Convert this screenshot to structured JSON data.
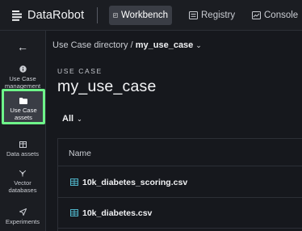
{
  "header": {
    "brand": "DataRobot",
    "nav": [
      {
        "label": "Workbench",
        "icon": "workbench-icon",
        "active": true
      },
      {
        "label": "Registry",
        "icon": "registry-icon",
        "active": false
      },
      {
        "label": "Console",
        "icon": "console-icon",
        "active": false
      }
    ]
  },
  "sidebar": {
    "back_icon": "arrow-left-icon",
    "items": [
      {
        "label": "Use Case management",
        "icon": "info-icon",
        "selected": false
      },
      {
        "label": "Use Case assets",
        "icon": "folder-icon",
        "selected": true
      },
      {
        "label": "Data assets",
        "icon": "table-icon",
        "selected": false
      },
      {
        "label": "Vector databases",
        "icon": "vector-icon",
        "selected": false
      },
      {
        "label": "Experiments",
        "icon": "experiments-icon",
        "selected": false
      }
    ]
  },
  "main": {
    "breadcrumb": {
      "parent": "Use Case directory",
      "separator": "/",
      "current": "my_use_case"
    },
    "overline": "USE CASE",
    "title": "my_use_case",
    "filter": "All",
    "table": {
      "columns": [
        "Name"
      ],
      "rows": [
        {
          "name": "10k_diabetes_scoring.csv",
          "icon": "dataset-table-icon"
        },
        {
          "name": "10k_diabetes.csv",
          "icon": "dataset-table-icon"
        }
      ]
    }
  },
  "colors": {
    "background": "#16181d",
    "panel": "#1b1d22",
    "highlight": "#6ef58a",
    "dataset_icon": "#4fb3c8"
  }
}
